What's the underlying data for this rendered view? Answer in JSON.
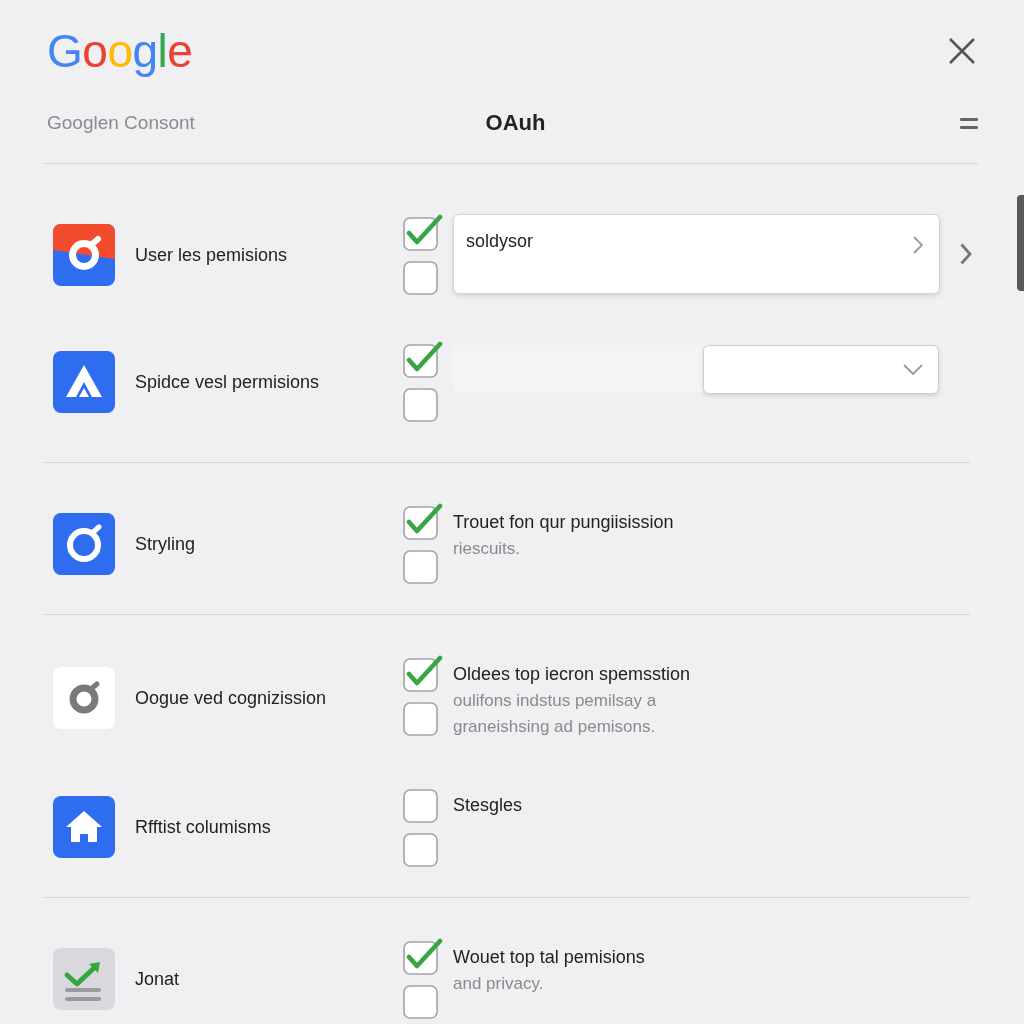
{
  "header": {
    "logo": "Google",
    "subtitle": "Googlen Consont",
    "title": "OAuh"
  },
  "sections": [
    {
      "items": [
        {
          "kind": "field",
          "label": "User les pemisions",
          "checks": [
            {
              "checked": true
            },
            {
              "checked": false
            }
          ],
          "field": {
            "value": "soldysor"
          }
        },
        {
          "kind": "dropdown",
          "label": "Spidce vesl permisions",
          "checks": [
            {
              "checked": true
            },
            {
              "checked": false
            }
          ]
        }
      ]
    },
    {
      "items": [
        {
          "kind": "text",
          "label": "Stryling",
          "checks": [
            {
              "checked": true
            },
            {
              "checked": false
            }
          ],
          "title": "Trouet fon qur pungiisission",
          "description": "riescuits."
        }
      ]
    },
    {
      "items": [
        {
          "kind": "text",
          "label": "Oogue ved cognizission",
          "checks": [
            {
              "checked": true
            },
            {
              "checked": false
            }
          ],
          "title": "Oldees top iecron spemsstion",
          "description": "oulifons indstus pemilsay a graneishsing ad pemisons."
        },
        {
          "kind": "text",
          "label": "Rfftist columisms",
          "checks": [
            {
              "checked": false
            },
            {
              "checked": false
            }
          ],
          "title": "Stesgles"
        }
      ]
    },
    {
      "items": [
        {
          "kind": "text",
          "label": "Jonat",
          "checks": [
            {
              "checked": true
            },
            {
              "checked": false
            }
          ],
          "title": "Wouet top tal pemisions",
          "description": "and privacy."
        }
      ]
    }
  ]
}
